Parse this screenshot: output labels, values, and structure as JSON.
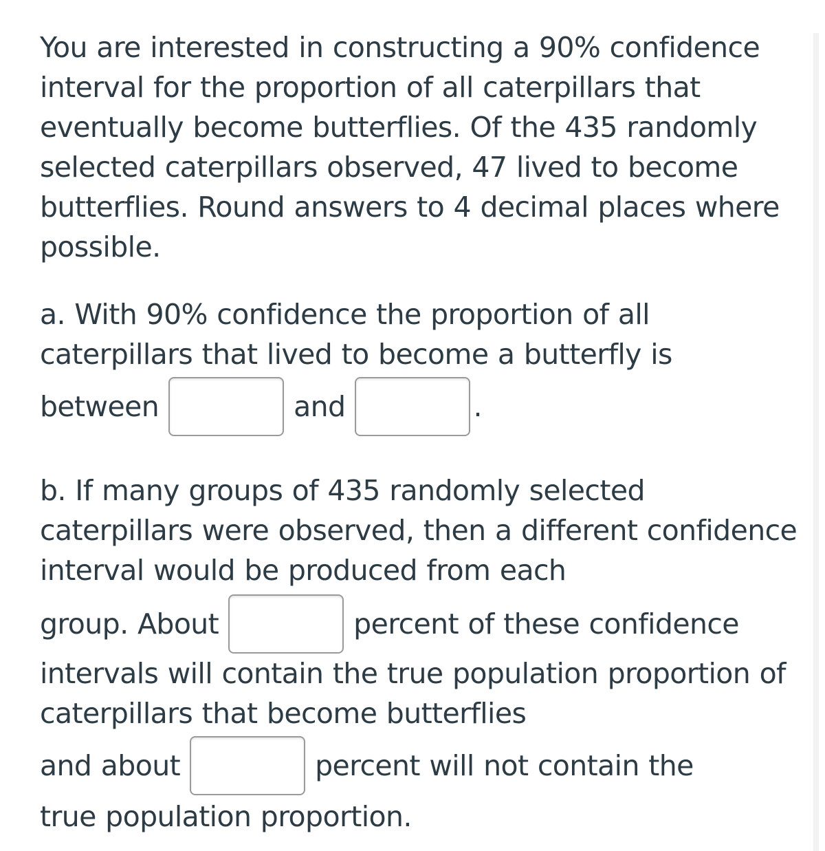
{
  "question": {
    "intro": "You are interested in constructing a 90% confidence interval for the proportion of all caterpillars that eventually become butterflies. Of the 435 randomly selected caterpillars observed, 47 lived to become butterflies. Round answers to 4 decimal places where possible.",
    "part_a": {
      "text": "a. With 90% confidence the proportion of all caterpillars that lived to become a butterfly is",
      "between_label": "between",
      "and_label": "and",
      "end_punct": ".",
      "lower_value": "",
      "upper_value": ""
    },
    "part_b": {
      "text": "b. If many groups of 435 randomly selected caterpillars were observed, then a different confidence interval would be produced from each",
      "group_about_label": "group. About",
      "percent_contain_label": "percent of these confidence",
      "middle_text": "intervals will contain the true population proportion of caterpillars that become butterflies",
      "and_about_label": "and about",
      "percent_not_label": "percent will not contain the",
      "tail_text": "true population proportion.",
      "contain_value": "",
      "not_contain_value": ""
    }
  }
}
